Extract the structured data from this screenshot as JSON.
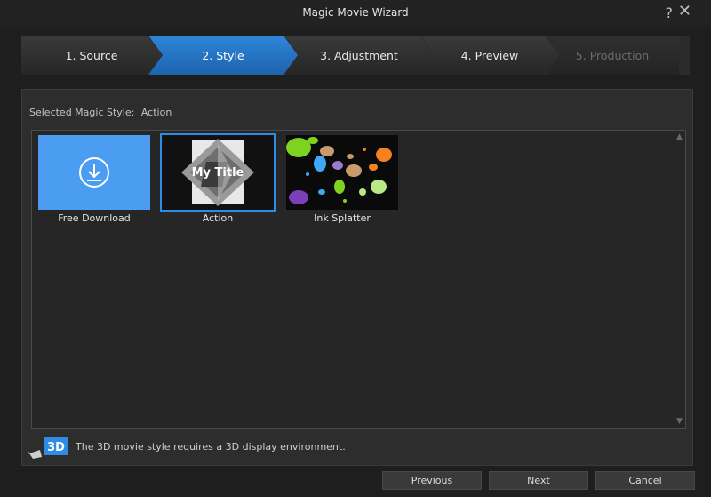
{
  "window": {
    "title": "Magic Movie Wizard",
    "help_glyph": "?",
    "close_glyph": "✕"
  },
  "steps": [
    {
      "label": "1. Source",
      "state": "normal"
    },
    {
      "label": "2. Style",
      "state": "active"
    },
    {
      "label": "3. Adjustment",
      "state": "normal"
    },
    {
      "label": "4. Preview",
      "state": "normal"
    },
    {
      "label": "5. Production",
      "state": "disabled"
    }
  ],
  "selected_style": {
    "label": "Selected Magic Style:",
    "value": "Action"
  },
  "styles": [
    {
      "name": "Free Download",
      "icon": "download-icon",
      "selected": false
    },
    {
      "name": "Action",
      "selected": true,
      "thumb_text": "My Title"
    },
    {
      "name": "Ink Splatter",
      "selected": false
    }
  ],
  "info": {
    "badge": "3D",
    "text": "The 3D movie style requires a 3D display environment."
  },
  "buttons": {
    "previous": "Previous",
    "next": "Next",
    "cancel": "Cancel"
  },
  "colors": {
    "accent": "#2c8ce6",
    "active_step": "#1d63ad",
    "download_tile": "#4a9df0"
  }
}
